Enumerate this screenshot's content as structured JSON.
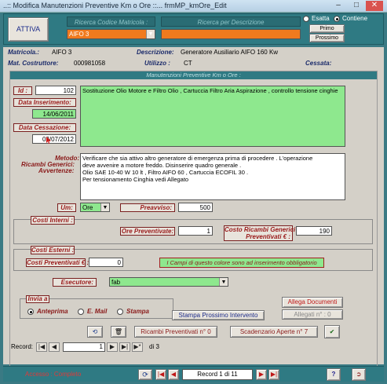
{
  "window": {
    "title": "..:: Modifica Manutenzioni Preventive Km o Ore ::...   frmMP_kmOre_Edit"
  },
  "header": {
    "attiva_label": "ATTIVA",
    "ricerca_codice_label": "Ricerca Codice Matricola :",
    "ricerca_codice_value": "AIFO 3",
    "ricerca_descrizione_label": "Ricerca per Descrizione",
    "ricerca_descrizione_value": "",
    "opt_esatta": "Esatta",
    "opt_contiene": "Contiene",
    "selected_option": "Contiene",
    "primo_label": "Primo",
    "prossimo_label": "Prossimo"
  },
  "info": {
    "matricola_label": "Matricola.:",
    "matricola_value": "AIFO 3",
    "descrizione_label": "Descrizione:",
    "descrizione_value": "Generatore Ausiliario AIFO  160 Kw",
    "mat_costruttore_label": "Mat. Costruttore:",
    "mat_costruttore_value": "000981058",
    "utilizzo_label": "Utilizzo :",
    "utilizzo_value": "CT",
    "cessata_label": "Cessata:",
    "cessata_value": ""
  },
  "form": {
    "section_title": "Manutenzioni Preventive Km o Ore :",
    "id_label": "Id :",
    "id_value": "102",
    "data_inserimento_label": "Data Inserimento:",
    "data_inserimento_value": "14/06/2011",
    "data_cessazione_label": "Data Cessazione:",
    "data_cessazione_value": "02/07/2012",
    "descrizione_intervento": "Sostituzione Olio Motore  e Filtro Olio , Cartuccia Filtro Aria Aspirazione , controllo tensione cinghie",
    "metodo_label": "Metodo:",
    "ricambi_label": "Ricambi Generici:",
    "avvertenze_label": "Avvertenze:",
    "note_lines": [
      "Verificare  che  sia  attivo altro generatore di emergenza prima di procedere . L'operazione",
      "deve avvenire a motore freddo.  Disinserire quadro generale .",
      "Olio SAE 10-40 W  10 lt ,  Filtro AIFO 60 ,  Cartuccia  ECOFIL 30 .",
      "Per tensionamento Cinghia vedi Allegato"
    ],
    "um_label": "Um:",
    "um_value": "Ore",
    "preavviso_label": "Preavviso:",
    "preavviso_value": "500",
    "costi_interni_label": "Costi Interni :",
    "ore_preventivate_label": "Ore Preventivate:",
    "ore_preventivate_value": "1",
    "costo_ricambi_label_1": "Costo Ricambi Generici",
    "costo_ricambi_label_2": "Preventivati € :",
    "costo_ricambi_value": "190",
    "costi_esterni_label": "Costi Esterni :",
    "costi_preventivati_label": "Costi Preventivati € :",
    "costi_preventivati_value": "0",
    "obbligatorio_note": "I Campi di questo colore sono ad inserimento obbligatorio",
    "esecutore_label": "Esecutore:",
    "esecutore_value": "fab",
    "invia_label": "Invia a",
    "invia_anteprima": "Anteprima",
    "invia_email": "E. Mail",
    "invia_stampa": "Stampa",
    "invia_selected": "Anteprima",
    "allega_documenti": "Allega Documenti",
    "allegati_label": "Allegati n° :  0",
    "stampa_prossimo": "Stampa Prossimo Intervento",
    "ricambi_preventivati": "Ricambi Preventivati n° 0",
    "scadenzario_aperte": "Scadenzario Aperte n° 7"
  },
  "nav": {
    "record_label": "Record:",
    "record_value": "1",
    "of_label": "di 3"
  },
  "statusbar": {
    "access_text": "Accesso : Completo",
    "record_text": "Record 1 di 11"
  },
  "colors": {
    "teal": "#2f7a83",
    "green_required": "#8ee88e",
    "orange_field": "#f07a1e"
  }
}
